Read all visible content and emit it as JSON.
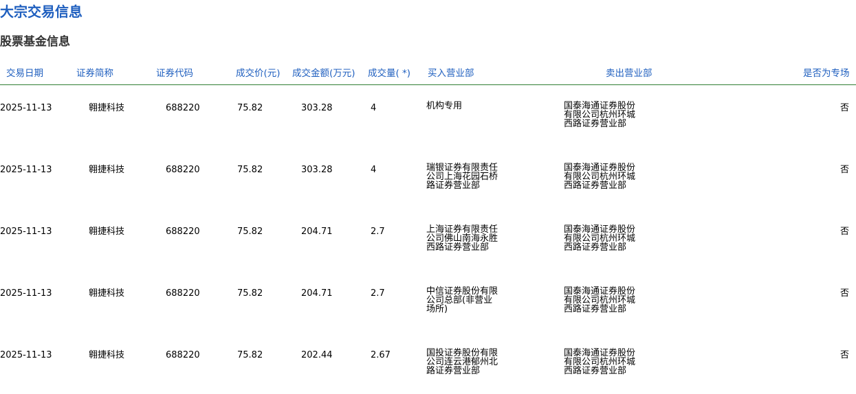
{
  "page": {
    "title": "大宗交易信息",
    "section_title": "股票基金信息"
  },
  "table": {
    "headers": {
      "date": "交易日期",
      "name": "证券简称",
      "code": "证券代码",
      "price": "成交价(元)",
      "amount": "成交金额(万元)",
      "volume": "成交量( *)",
      "buyer": "买入营业部",
      "seller": "卖出营业部",
      "special": "是否为专场"
    },
    "rows": [
      {
        "date": "2025-11-13",
        "name": "翱捷科技",
        "code": "688220",
        "price": "75.82",
        "amount": "303.28",
        "volume": "4",
        "buyer": "机构专用",
        "seller": "国泰海通证券股份有限公司杭州环城西路证券营业部",
        "special": "否"
      },
      {
        "date": "2025-11-13",
        "name": "翱捷科技",
        "code": "688220",
        "price": "75.82",
        "amount": "303.28",
        "volume": "4",
        "buyer": "瑞银证券有限责任公司上海花园石桥路证券营业部",
        "seller": "国泰海通证券股份有限公司杭州环城西路证券营业部",
        "special": "否"
      },
      {
        "date": "2025-11-13",
        "name": "翱捷科技",
        "code": "688220",
        "price": "75.82",
        "amount": "204.71",
        "volume": "2.7",
        "buyer": "上海证券有限责任公司佛山南海永胜西路证券营业部",
        "seller": "国泰海通证券股份有限公司杭州环城西路证券营业部",
        "special": "否"
      },
      {
        "date": "2025-11-13",
        "name": "翱捷科技",
        "code": "688220",
        "price": "75.82",
        "amount": "204.71",
        "volume": "2.7",
        "buyer": "中信证券股份有限公司总部(非营业场所)",
        "seller": "国泰海通证券股份有限公司杭州环城西路证券营业部",
        "special": "否"
      },
      {
        "date": "2025-11-13",
        "name": "翱捷科技",
        "code": "688220",
        "price": "75.82",
        "amount": "202.44",
        "volume": "2.67",
        "buyer": "国投证券股份有限公司连云港郁州北路证券营业部",
        "seller": "国泰海通证券股份有限公司杭州环城西路证券营业部",
        "special": "否"
      }
    ]
  }
}
